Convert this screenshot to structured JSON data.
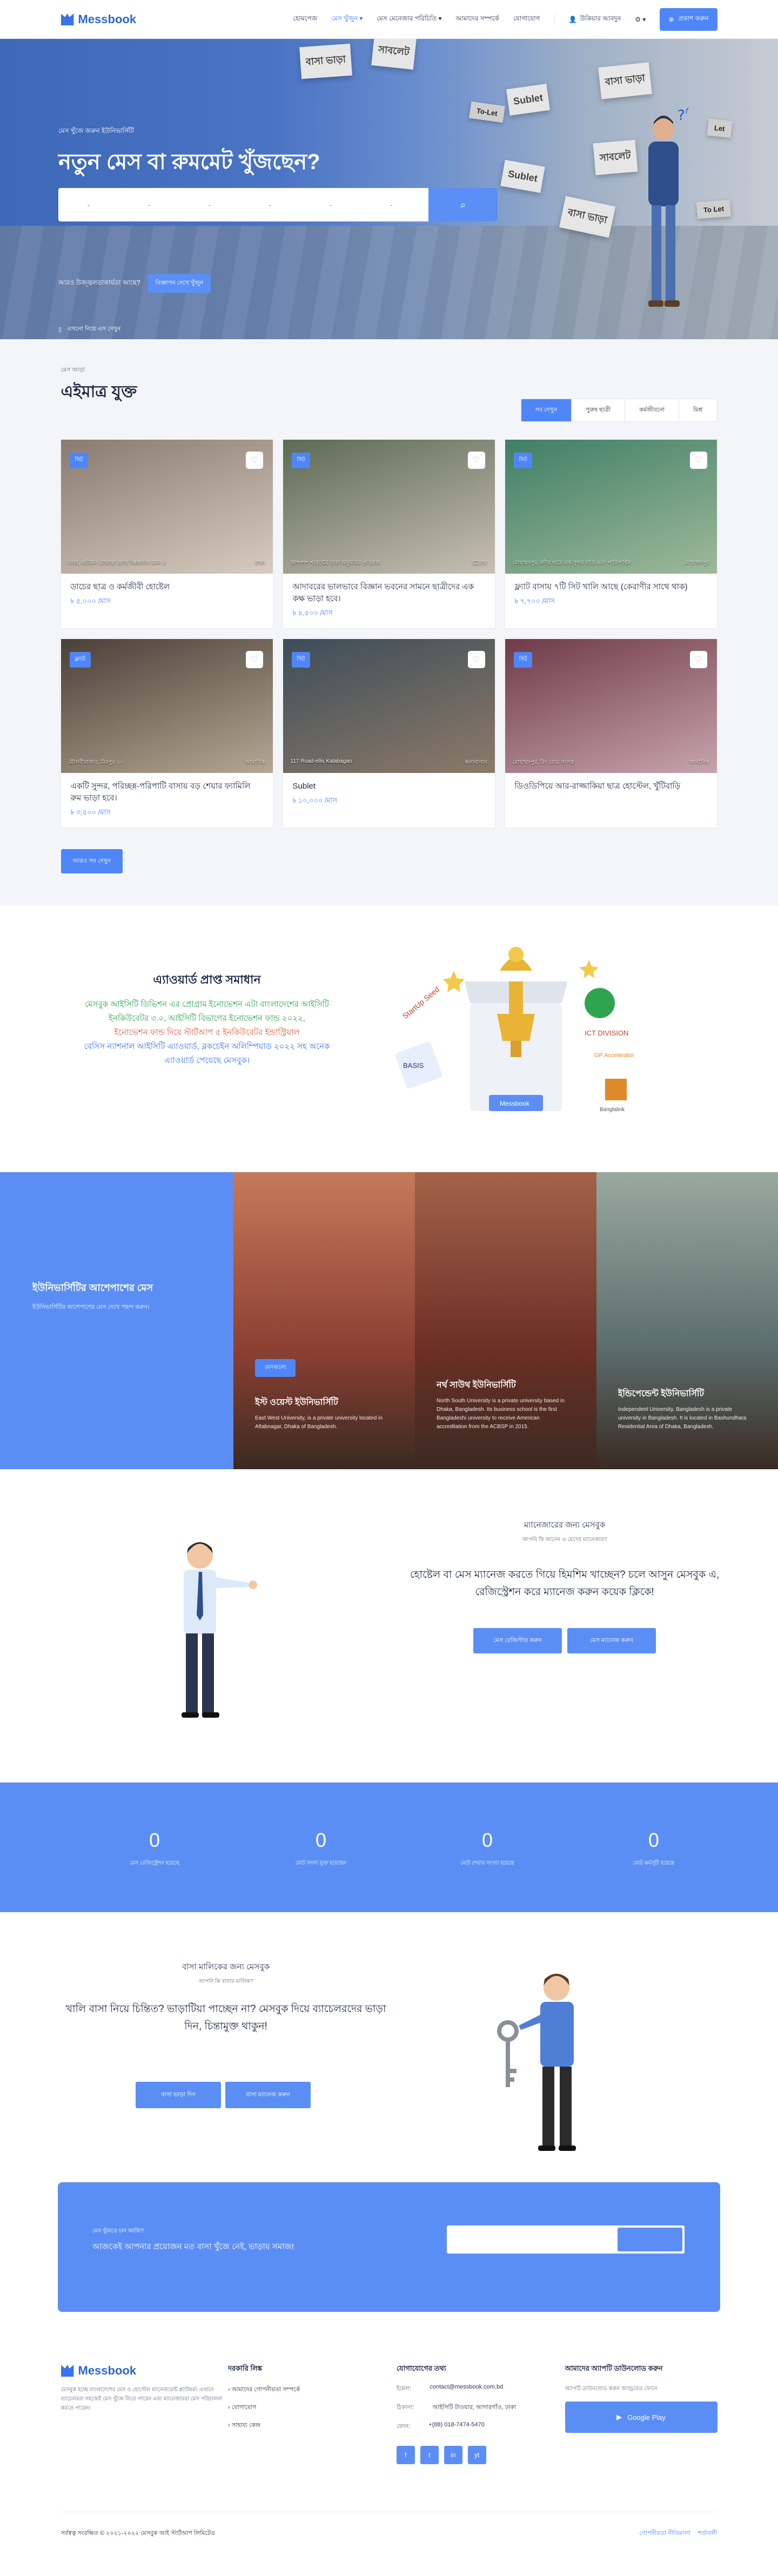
{
  "header": {
    "logo": "Messbook",
    "nav": [
      "হোমপেজ",
      "মেস খুঁজুন",
      "মেস মেনেজার পরিচিতি",
      "আমাদের সম্পর্কে",
      "যোগাযোগ"
    ],
    "login": "উকিয়ার আবদুন",
    "cta": "প্রকাশ করুন"
  },
  "hero": {
    "tagline": "মেস খুঁজে জরুন ইউনিভার্সিটি",
    "title": "নতুন মেস বা রুমমেট খুঁজছেন?",
    "search_fields": [
      "-",
      "-",
      "-",
      "-",
      "-",
      "-"
    ],
    "question": "আরও উজ্জ্বলতাকার্যতা আছে?",
    "question_btn": "বিজ্ঞাপন দেখে খুঁজুন",
    "app": "এখনো নিয়ে এস দেখুন",
    "signs": [
      "বাসা ভাড়া",
      "সাবলেট",
      "Sublet",
      "To-Let",
      "বাসা ভাড়া",
      "Sublet",
      "সাবলেট",
      "বাসা ভাড়া",
      "To Let",
      "Let"
    ]
  },
  "listings": {
    "subtitle": "মেস আড়া",
    "title": "এইমাত্র যুক্ত",
    "filters": [
      "সব দেখুন",
      "পুরুষ ছাত্রী",
      "কর্মজীবনো",
      "মিশ্র"
    ],
    "cards": [
      {
        "badge": "সিট",
        "location": "ঢাকা, কাঁটাবন চৌরাস্তা মোড় বিশ্বজনীন ভবন ৫",
        "meta": "ঢাকা",
        "title": "ডাচের ছাত্র ও কর্মজীবী হোষ্টেল",
        "price": "৳ ৫,০০০ /মাস",
        "img": [
          "#8a7a70",
          "#d7ccbf"
        ]
      },
      {
        "badge": "সিট",
        "location": "আশপাশ পয়েন্টের ঢাকা অনুমতির প্রতিষ্ঠান",
        "meta": "চট্টগ্রাম",
        "title": "আদাবরের ভালভাবে বিজ্ঞান ভবনের সামনে ছাত্রীদের এক কক্ষ ভাড়া হবে।",
        "price": "৳ ৪,৫০০ /মাস",
        "img": [
          "#5c6a55",
          "#c9c0b3"
        ]
      },
      {
        "badge": "সিট",
        "location": "মোহাম্মদপুর, নদীর ধারে এক সুন্দর বাড়ি এবং পারিপার্শ্বিক",
        "meta": "মোহাম্মদপুর",
        "title": "ফ্ল্যাট বাসায় ৭টি সিট খালি আছে (কেরাণীর সাথে থাক)",
        "price": "৳ ৭,৭০০ /মাস",
        "img": [
          "#3f7f66",
          "#9fb99a"
        ]
      },
      {
        "badge": "ফ্ল্যাট",
        "location": "মৌলবীবাজার, মিরপুর-১০",
        "meta": "আবাসিক",
        "title": "একটি সুন্দর, পরিচ্ছন্ন-পরিপাটি বাসায় বড় শেয়ার ফ্যামিলি রুম ভাড়া হবে।",
        "price": "৳ ৩,৫০০ /মাস",
        "img": [
          "#4a4038",
          "#b5a792"
        ]
      },
      {
        "badge": "সিট",
        "location": "117 Road-ellis Kalabagan",
        "meta": "কলাবাগান",
        "title": "Sublet",
        "price": "৳ ১০,০০০ /মাস",
        "img": [
          "#3d4d59",
          "#8c7a68"
        ]
      },
      {
        "badge": "সিট",
        "location": "মোহাম্মদপুর, রিং রোড সংলগ্ন",
        "meta": "আবাসিক",
        "title": "ডিওডিপিয়ে আর-রাজ্জাকিয়া ছাত্র হোস্টেল, খুঁটিবাড়ি",
        "price": "",
        "img": [
          "#6f3a48",
          "#c7a4ad"
        ]
      }
    ],
    "see_all": "আরও সব দেখুন"
  },
  "award": {
    "title": "এ্যাওয়ার্ড প্রাপ্ত সমাধান",
    "lines_green": "মেসবুক আইসিটি ডিভিশন এর প্রোগ্রাম ইনোভেশন এটা বাংলাদেশের আইসিটি ইনকিউবেটর ৩.০, আইসিটি বিভাগের ইনোভেশন ফান্ড ২০২২,",
    "lines_red": "ইনোভেশন ফান্ড দিয়ে স্টার্টআপ ৫ ইনকিউবেটর ইন্ডাস্ট্রিয়াল",
    "lines_blue": "বেসিস ন্যাশনাল আইসিটি এ্যাওয়ার্ড, ব্লকচেইন অলিম্পিয়াড ২০২২ সহ অনেক এ্যাওয়ার্ড পেয়েছে মেসবুক।",
    "logos": [
      "ICT DIVISION",
      "StartUp Seed",
      "Messbook",
      "BASIS",
      "GP Accelerator",
      "Banglalink"
    ]
  },
  "universities": {
    "title": "ইউনিভার্সিটির আশেপাশের মেস",
    "subtitle": "ইউনিভার্সিটির আশেপাশের মেস দেখে পছন্দ করুন।",
    "btn": "মেসগুলো",
    "items": [
      {
        "name": "ইস্ট ওয়েস্ট ইউনিভার্সিটি",
        "desc": "East West University, is a private university located in Aftabnagar, Dhaka of Bangladesh.",
        "colors": [
          "#8b3f32",
          "#c67a5b"
        ]
      },
      {
        "name": "নর্থ সাউথ ইউনিভার্সিটি",
        "desc": "North South University is a private university based in Dhaka, Bangladesh. Its business school is the first Bangladeshi university to receive American accreditation from the ACBSP in 2015.",
        "colors": [
          "#6b2f25",
          "#a4624a"
        ]
      },
      {
        "name": "ইন্ডিপেন্ডেন্ট ইউনিভার্সিটি",
        "desc": "Independent University, Bangladesh is a private university in Bangladesh. It is located in Bashundhara Residential Area of Dhaka, Bangladesh.",
        "colors": [
          "#5a6c6c",
          "#9aa9a0"
        ]
      }
    ]
  },
  "manage": {
    "title": "ম্যানেজারের জন্য মেসবুক",
    "subtitle": "আপনি কি জানেন এ মেসের ম্যানেজার?",
    "text": "হোষ্টেল বা মেস ম্যানেজ করতে গিয়ে হিমশিম খাচ্ছেন? চলে আসুন মেসবুক এ, রেজিস্ট্রেশন করে ম্যানেজ করুন কয়েক ক্লিকে!",
    "btn1": "মেস রেজিস্টার করুন",
    "btn2": "মেস ম্যানেজ করুন"
  },
  "stats": [
    {
      "value": "0",
      "label": "মেস রেজিস্ট্রেশন হয়েছে"
    },
    {
      "value": "0",
      "label": "মোট সদস্য যুক্ত হয়েছেন"
    },
    {
      "value": "0",
      "label": "মোট শেয়ার সংখ্যা হয়েছে"
    },
    {
      "value": "0",
      "label": "মোট কর্মসূচী হয়েছে"
    }
  ],
  "owner": {
    "title": "বাসা মালিকের জন্য মেসবুক",
    "subtitle": "আপনি কি বাসার মালিক?",
    "text": "খালি বাসা নিয়ে চিন্তিত? ভাড়াটিয়া পাচ্ছেন না? মেসবুক দিয়ে ব্যাচেলরদের ভাড়া দিন, চিন্তামুক্ত থাকুন!",
    "btn1": "বাসা ভাড়া দিন",
    "btn2": "বাসা ম্যানেজ করুন"
  },
  "newsletter": {
    "small": "মেস খুঁজতে চান আজি?",
    "text": "আজকেই আপনার প্রয়োজন মত বাসা খুঁজে নেই, ভাড়ায় সমাজ!"
  },
  "footer": {
    "logo": "Messbook",
    "about": "মেসবুক হচ্ছে বাংলাদেশের মেস ও হোস্টেল ম্যানেজমেন্ট প্ল্যাটফর্ম। এখানে ব্যাচেলররা সহজেই মেস খুঁজে নিতে পারেন এবং ম্যানেজাররা মেস পরিচালনা করতে পারেন।",
    "links_title": "দরকারি লিঙ্ক",
    "links": [
      "আমাদের গোপনীয়তা সম্পর্কে",
      "যোগাযোগ",
      "সাহায্য কেন্দ্র"
    ],
    "contact_title": "যোগাযোগের তথ্য",
    "contact": [
      {
        "k": "ইমেল:",
        "v": "contact@messbook.com.bd"
      },
      {
        "k": "ঠিকানা:",
        "v": "আইসিটি টাওয়ার, আগারগাঁও, ঢাকা"
      },
      {
        "k": "ফোন:",
        "v": "+(88) 018-7474-5470"
      }
    ],
    "social": [
      "f",
      "t",
      "in",
      "yt"
    ],
    "app_title": "আমাদের অ্যাপটি ডাউনলোড করুন",
    "app_text": "অ্যাপটি ডাউনলোড করুন অ্যান্ড্রয়েড ফোনে",
    "app_btn": "Google Play",
    "copyright": "সর্বস্বত্ব সংরক্ষিত © ২০২১-২০২২ মেসবুক আই স্টার্টআপ লিমিটেড",
    "bottom_links": [
      "গোপনীয়তা নীতিমালা",
      "শর্তাবলী"
    ]
  }
}
